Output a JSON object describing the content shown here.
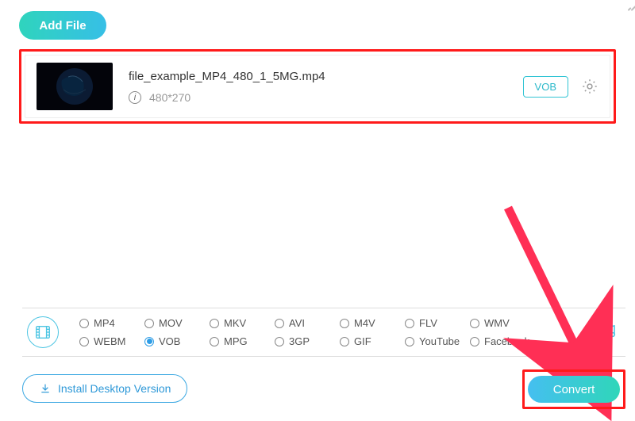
{
  "toolbar": {
    "add_file_label": "Add File"
  },
  "file": {
    "name": "file_example_MP4_480_1_5MG.mp4",
    "resolution": "480*270",
    "output_format": "VOB"
  },
  "formats": {
    "selected": "VOB",
    "items": [
      "MP4",
      "MOV",
      "MKV",
      "AVI",
      "M4V",
      "FLV",
      "WMV",
      "WEBM",
      "VOB",
      "MPG",
      "3GP",
      "GIF",
      "YouTube",
      "Facebook"
    ]
  },
  "footer": {
    "install_label": "Install Desktop Version",
    "convert_label": "Convert"
  },
  "colors": {
    "accent": "#2fd4bd",
    "highlight": "#ff1a1a"
  }
}
